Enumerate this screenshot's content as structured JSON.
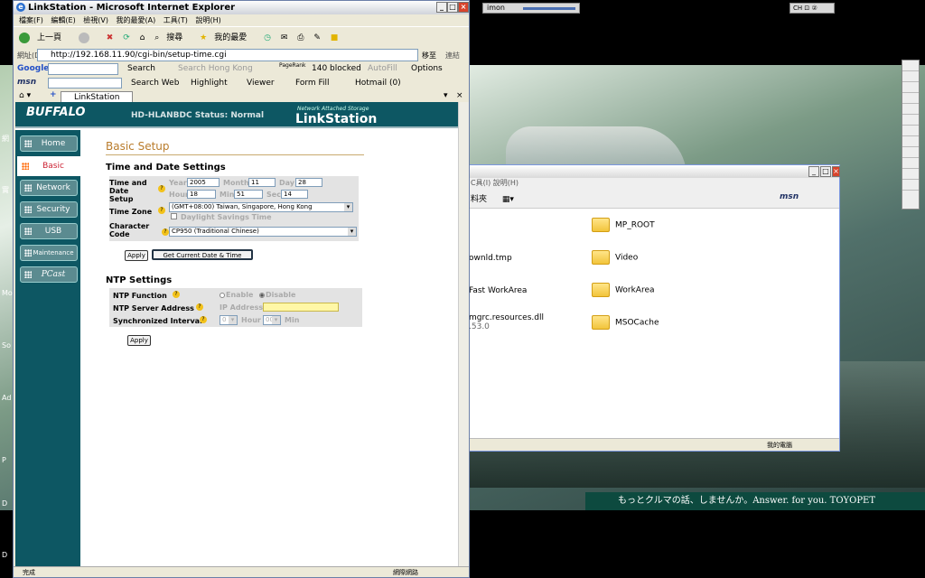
{
  "desktop": {
    "imon_label": "imon",
    "tray_text": "CH ⊡ ②",
    "ad_text": "もっとクルマの話、しませんか。Answer. for you. TOYOPET",
    "left_labels": [
      "網",
      "實",
      "Mo",
      "So",
      "Ad",
      "P",
      "D",
      "D"
    ]
  },
  "explorer": {
    "menu": "C具(I)   說明(H)",
    "toolbar_left": "料夾",
    "msn": "msn",
    "items": [
      {
        "name": "MP_ROOT",
        "folder": true
      },
      {
        "name": "ownld.tmp",
        "folder": false
      },
      {
        "name": "Video",
        "folder": true
      },
      {
        "name": "Fast WorkArea",
        "folder": false
      },
      {
        "name": "WorkArea",
        "folder": true
      },
      {
        "name": "mgrc.resources.dll",
        "folder": false,
        "sub": ".53.0"
      },
      {
        "name": "MSOCache",
        "folder": true
      }
    ],
    "status": "我的電腦"
  },
  "ie": {
    "title": "LinkStation - Microsoft Internet Explorer",
    "menu": [
      "檔案(F)",
      "編輯(E)",
      "檢視(V)",
      "我的最愛(A)",
      "工具(T)",
      "說明(H)"
    ],
    "toolbar": {
      "back": "上一頁",
      "search": "搜尋",
      "favorites": "我的最愛"
    },
    "address_label": "網址(D)",
    "address": "http://192.168.11.90/cgi-bin/setup-time.cgi",
    "go": "移至",
    "links": "連結",
    "google_bar": {
      "brand": "Google",
      "search": "Search",
      "search_hk": "Search Hong Kong",
      "pagerank": "PageRank",
      "blocked": "140 blocked",
      "autofill": "AutoFill",
      "options": "Options"
    },
    "msn_bar": {
      "brand": "msn",
      "search_web": "Search Web",
      "highlight": "Highlight",
      "viewer": "Viewer",
      "form_fill": "Form Fill",
      "hotmail": "Hotmail (0)"
    },
    "tab_label": "LinkStation",
    "status_text": "完成",
    "status_zone": "網際網路"
  },
  "ls": {
    "logo": "BUFFALO",
    "status": "HD-HLANBDC Status: Normal",
    "brand_small": "Network Attached Storage",
    "brand": "LinkStation",
    "nav": [
      "Home",
      "Basic",
      "Network",
      "Security",
      "USB",
      "Maintenance",
      "PCast"
    ],
    "page_title": "Basic Setup",
    "time_section": "Time and Date Settings",
    "time_date_label": "Time and Date Setup",
    "year_label": "Year",
    "year": "2005",
    "month_label": "Month",
    "month": "11",
    "day_label": "Day",
    "day": "28",
    "hour_label": "Hour",
    "hour": "18",
    "min_label": "Min",
    "min": "51",
    "sec_label": "Sec",
    "sec": "14",
    "time_zone_label": "Time Zone",
    "time_zone": "(GMT+08:00) Taiwan, Singapore, Hong Kong",
    "dst_label": "Daylight Savings Time",
    "charset_label": "Character Code",
    "charset": "CP950 (Traditional Chinese)",
    "apply": "Apply",
    "get_time": "Get Current Date & Time",
    "ntp_section": "NTP Settings",
    "ntp_function_label": "NTP Function",
    "enable": "Enable",
    "disable": "Disable",
    "ntp_server_label": "NTP Server Address",
    "ip_label": "IP Address:",
    "sync_label": "Synchronized Interval",
    "sync_value": "0",
    "hour_unit": "Hour",
    "min_value": "00",
    "min_unit": "Min",
    "apply2": "Apply"
  }
}
